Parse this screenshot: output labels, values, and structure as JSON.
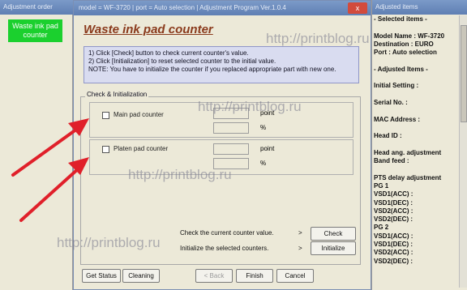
{
  "left_panel": {
    "title": "Adjustment order",
    "selected_item": "Waste ink pad counter"
  },
  "dialog": {
    "title": "model = WF-3720 | port = Auto selection | Adjustment Program Ver.1.0.4",
    "close_label": "x",
    "heading": "Waste ink pad counter",
    "instructions": [
      "1) Click [Check] button to check current counter's value.",
      "2) Click [Initialization] to reset selected counter to the initial value.",
      "NOTE: You have to initialize the counter if you replaced appropriate part with new one."
    ],
    "frame_title": "Check & Initialization",
    "main_pad": {
      "label": "Main pad counter",
      "unit_point": "point",
      "unit_percent": "%",
      "checked": false
    },
    "platen_pad": {
      "label": "Platen pad counter",
      "unit_point": "point",
      "unit_percent": "%",
      "checked": false
    },
    "check_row": {
      "text": "Check the current counter value.",
      "arrow": ">",
      "button": "Check"
    },
    "init_row": {
      "text": "Initialize the selected counters.",
      "arrow": ">",
      "button": "Initialize"
    },
    "footer": {
      "get_status": "Get Status",
      "cleaning": "Cleaning",
      "back": "< Back",
      "finish": "Finish",
      "cancel": "Cancel"
    }
  },
  "right_panel": {
    "title": "Adjusted items",
    "lines": [
      "- Selected items -",
      "",
      "Model Name : WF-3720",
      "Destination : EURO",
      "Port : Auto selection",
      "",
      "- Adjusted Items -",
      "",
      "Initial Setting :",
      "",
      "Serial No. :",
      "",
      "MAC Address :",
      "",
      "Head ID :",
      "",
      "Head ang. adjustment",
      "  Band feed :",
      "",
      "PTS delay adjustment",
      "  PG 1",
      "  VSD1(ACC) :",
      "  VSD1(DEC) :",
      "  VSD2(ACC) :",
      "  VSD2(DEC) :",
      "  PG 2",
      "  VSD1(ACC) :",
      "  VSD1(DEC) :",
      "  VSD2(ACC) :",
      "  VSD2(DEC) :"
    ]
  },
  "watermarks": [
    "http://printblog.ru",
    "http://printblog.ru",
    "http://printblog.ru",
    "http://printblog.ru"
  ],
  "colors": {
    "selected_item": "#1bd02e",
    "heading": "#8a3a1c",
    "arrow": "#e0202a",
    "titlebar": "#6f8fc0"
  }
}
